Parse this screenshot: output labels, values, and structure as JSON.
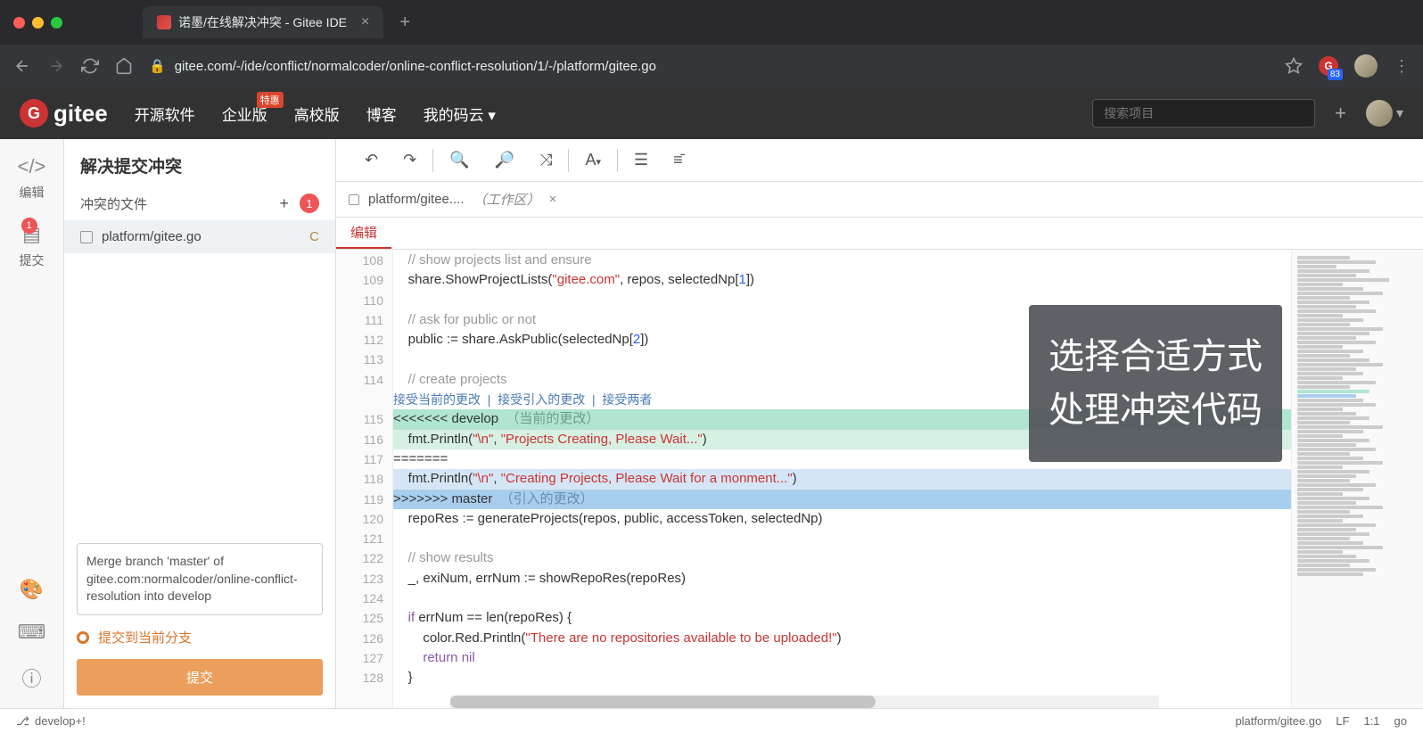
{
  "browser": {
    "tab_title": "诺墨/在线解决冲突 - Gitee IDE",
    "url": "gitee.com/-/ide/conflict/normalcoder/online-conflict-resolution/1/-/platform/gitee.go",
    "ext_count": "83"
  },
  "gitee_nav": {
    "brand": "gitee",
    "links": [
      "开源软件",
      "企业版",
      "高校版",
      "博客",
      "我的码云"
    ],
    "enterprise_badge": "特惠",
    "search_placeholder": "搜索项目"
  },
  "rail": {
    "edit": "编辑",
    "commit": "提交",
    "commit_badge": "1"
  },
  "sidebar": {
    "title": "解决提交冲突",
    "section": "冲突的文件",
    "count_badge": "1",
    "file": "platform/gitee.go",
    "file_mark": "C",
    "commit_msg": "Merge branch 'master' of gitee.com:normalcoder/online-conflict-resolution into develop",
    "commit_to": "提交到当前分支",
    "commit_btn": "提交"
  },
  "editor": {
    "tab_file": "platform/gitee....",
    "tab_work": "（工作区）",
    "subtab": "编辑",
    "conflict_actions": {
      "accept_current": "接受当前的更改",
      "accept_incoming": "接受引入的更改",
      "accept_both": "接受两者"
    },
    "current_label": "（当前的更改）",
    "incoming_label": "（引入的更改）",
    "lines": {
      "108": "// show projects list and ensure",
      "109": [
        "share.ShowProjectLists(",
        "\"gitee.com\"",
        ", repos, selectedNp[",
        "1",
        "])"
      ],
      "111": "// ask for public or not",
      "112": [
        "public := share.AskPublic(selectedNp[",
        "2",
        "])"
      ],
      "114": "// create projects",
      "115": "<<<<<<< develop",
      "116": [
        "fmt.Println(",
        "\"\\n\"",
        ", ",
        "\"Projects Creating, Please Wait...\"",
        ")"
      ],
      "117": "=======",
      "118": [
        "fmt.Println(",
        "\"\\n\"",
        ", ",
        "\"Creating Projects, Please Wait for a monment...\"",
        ")"
      ],
      "119": ">>>>>>> master",
      "120": "repoRes := generateProjects(repos, public, accessToken, selectedNp)",
      "122": "// show results",
      "123": "_, exiNum, errNum := showRepoRes(repoRes)",
      "125": [
        "if",
        " errNum == len(repoRes) {"
      ],
      "126": [
        "color.Red.Println(",
        "\"There are no repositories available to be uploaded!\"",
        ")"
      ],
      "127": [
        "return",
        " ",
        "nil"
      ],
      "128": "}"
    },
    "gutter": [
      "108",
      "109",
      "110",
      "111",
      "112",
      "113",
      "114",
      "",
      "115",
      "116",
      "117",
      "118",
      "119",
      "120",
      "121",
      "122",
      "123",
      "124",
      "125",
      "126",
      "127",
      "128"
    ]
  },
  "overlay": {
    "line1": "选择合适方式",
    "line2": "处理冲突代码"
  },
  "status": {
    "branch": "develop+!",
    "file": "platform/gitee.go",
    "encoding": "LF",
    "pos": "1:1",
    "lang": "go"
  }
}
